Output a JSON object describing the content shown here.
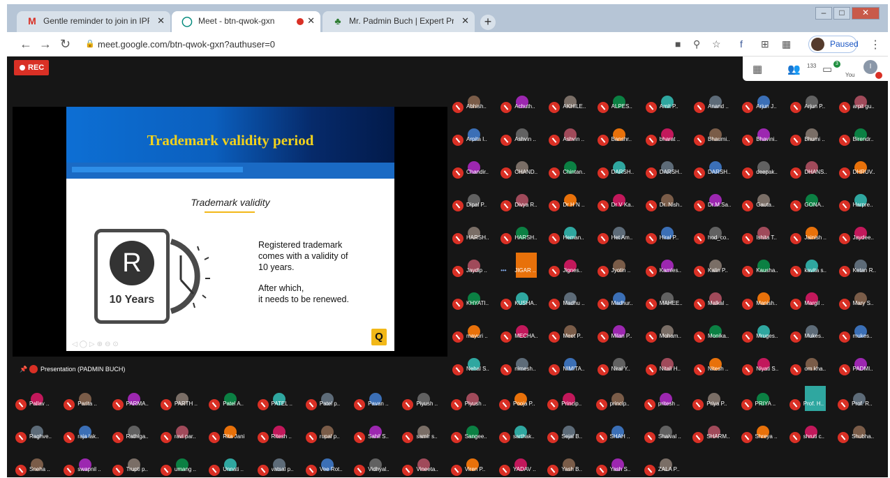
{
  "browser": {
    "tabs": [
      {
        "icon": "gmail-icon",
        "title": "Gentle reminder to join in IPR we",
        "active": false
      },
      {
        "icon": "meet-icon",
        "title": "Meet - btn-qwok-gxn",
        "active": true
      },
      {
        "icon": "page-icon",
        "title": "Mr. Padmin Buch | Expert Profess",
        "active": false
      }
    ],
    "url": "meet.google.com/btn-qwok-gxn?authuser=0",
    "profile_label": "Paused"
  },
  "meet": {
    "rec_label": "REC",
    "people_count": "133",
    "chat_badge": "3",
    "you_label": "You",
    "you_initial": "I",
    "presentation_label": "Presentation (PADMIN BUCH)",
    "slide": {
      "title": "Trademark validity period",
      "subtitle": "Trademark validity",
      "icon_letter": "R",
      "icon_caption": "10 Years",
      "line1": "Registered trademark",
      "line2": "comes with a validity of",
      "line3": "10 years.",
      "line4": "After which,",
      "line5": "it needs to be renewed.",
      "logo": "Q"
    },
    "participants": [
      [
        "Abhish..",
        "Achuth..",
        "AKHILE..",
        "ALPES..",
        "Amit P..",
        "Anand ..",
        "Arjun J..",
        "Arjun P..",
        "arpit gu.."
      ],
      [
        "Arpita I..",
        "Ashvin ..",
        "Ashvin ..",
        "Banshr..",
        "bharat ..",
        "Bhaumi..",
        "Bhavini..",
        "Bhumi ..",
        "Birendr.."
      ],
      [
        "Chandir..",
        "CHAND..",
        "Chintan..",
        "DARSH..",
        "DARSH..",
        "DARSH..",
        "deepak..",
        "DHANS..",
        "DHRUV.."
      ],
      [
        "Dipal P..",
        "Divya R..",
        "Dr H N ..",
        "Dr V Ka..",
        "Dr. Nish..",
        "Dr.M.Sa..",
        "Gauta..",
        "GONA..",
        "Harpre.."
      ],
      [
        "HARSH..",
        "HARSH..",
        "Heman..",
        "Het Am..",
        "Hiral P..",
        "hod_co..",
        "Ishita T..",
        "Jainish ..",
        "Jaydee.."
      ],
      [
        "Jaydip ..",
        "JIGAR ..",
        "Jignes..",
        "Jyotin ..",
        "Kamles..",
        "Kalin P..",
        "Kausha..",
        "kavita s..",
        "Ketan R.."
      ],
      [
        "KHYATI..",
        "KUSHA..",
        "Madhu ..",
        "Madhur..",
        "MAHEE..",
        "Malkal ..",
        "Manish..",
        "Margil ..",
        "Mary S.."
      ],
      [
        "mayuri ..",
        "MECHA..",
        "Meet P..",
        "Milan P..",
        "Moham..",
        "Monika..",
        "Mruges..",
        "Mukes..",
        "mukes.."
      ],
      [
        "Nehal S..",
        "nimesh..",
        "NIMITA..",
        "Niral Y..",
        "Nitali H..",
        "Nitesh ..",
        "Niyati S..",
        "om kha..",
        "PADMI.."
      ],
      [
        "Pallav ..",
        "Parita ..",
        "PARMA..",
        "PARTH ..",
        "Patel A..",
        "PATEL ..",
        "Patel p..",
        "Pavan ..",
        "Piyush ..",
        "Piyush ..",
        "Pooja P..",
        "Princip..",
        "princip..",
        "pritesh ..",
        "Priya P..",
        "PRIYA ..",
        "Prof. H..",
        "Prof. R.."
      ],
      [
        "Raghve..",
        "raja lak..",
        "Rathiga..",
        "ravi par..",
        "Rita Jani",
        "Ritesh ..",
        "rupal p..",
        "Sahil S..",
        "samir s..",
        "Sangee..",
        "sarthak..",
        "Sejal B..",
        "SHAH ..",
        "Shaival ..",
        "SHARM..",
        "Shreya ..",
        "shruti c..",
        "Shubha.."
      ],
      [
        "Sneha ..",
        "swapnil ..",
        "Trupti p..",
        "umang ..",
        "Unnati ..",
        "vatsal p..",
        "Vee Rot..",
        "Vidhyal..",
        "Vineeta..",
        "Viren P..",
        "YADAV ..",
        "Yash B..",
        "Yash S..",
        "ZALA P.."
      ]
    ],
    "avatar_colors": [
      "#7a5c48",
      "#2fa7a0",
      "#a04a5a",
      "#9c27b0",
      "#5d6b78",
      "#e8710a",
      "#7a6e66",
      "#3b6fb6",
      "#c2185b",
      "#0b8043",
      "#616161"
    ]
  }
}
